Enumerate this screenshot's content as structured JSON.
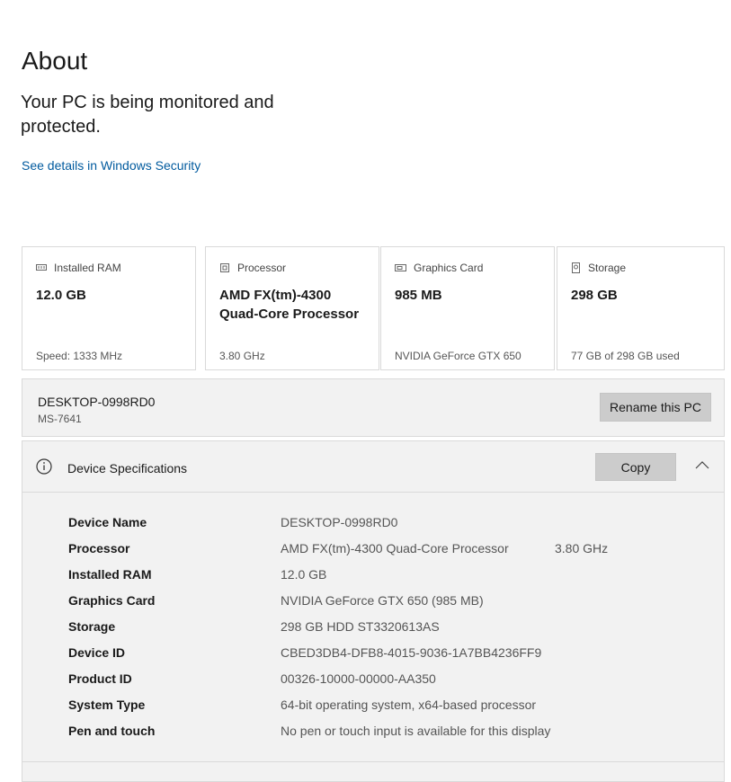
{
  "header": {
    "title": "About",
    "protection_message": "Your PC is being monitored and protected.",
    "security_link": "See details in Windows Security"
  },
  "cards": [
    {
      "icon": "ram-icon",
      "label": "Installed RAM",
      "value": "12.0 GB",
      "detail": "Speed: 1333 MHz"
    },
    {
      "icon": "processor-icon",
      "label": "Processor",
      "value": "AMD FX(tm)-4300 Quad-Core Processor",
      "detail": "3.80 GHz"
    },
    {
      "icon": "graphics-card-icon",
      "label": "Graphics Card",
      "value": "985 MB",
      "detail": "NVIDIA GeForce GTX 650"
    },
    {
      "icon": "storage-icon",
      "label": "Storage",
      "value": "298 GB",
      "detail": "77 GB of 298 GB used"
    }
  ],
  "pc": {
    "name": "DESKTOP-0998RD0",
    "model": "MS-7641",
    "rename_label": "Rename this PC"
  },
  "specs": {
    "title": "Device Specifications",
    "copy_label": "Copy",
    "rows": [
      {
        "label": "Device Name",
        "value": "DESKTOP-0998RD0",
        "extra": ""
      },
      {
        "label": "Processor",
        "value": "AMD FX(tm)-4300 Quad-Core Processor",
        "extra": "3.80 GHz"
      },
      {
        "label": "Installed RAM",
        "value": "12.0 GB",
        "extra": ""
      },
      {
        "label": "Graphics Card",
        "value": "NVIDIA GeForce GTX 650 (985 MB)",
        "extra": ""
      },
      {
        "label": "Storage",
        "value": "298 GB HDD ST3320613AS",
        "extra": ""
      },
      {
        "label": "Device ID",
        "value": "CBED3DB4-DFB8-4015-9036-1A7BB4236FF9",
        "extra": ""
      },
      {
        "label": "Product ID",
        "value": "00326-10000-00000-AA350",
        "extra": ""
      },
      {
        "label": "System Type",
        "value": "64-bit operating system, x64-based processor",
        "extra": ""
      },
      {
        "label": "Pen and touch",
        "value": "No pen or touch input is available for this display",
        "extra": ""
      }
    ]
  }
}
